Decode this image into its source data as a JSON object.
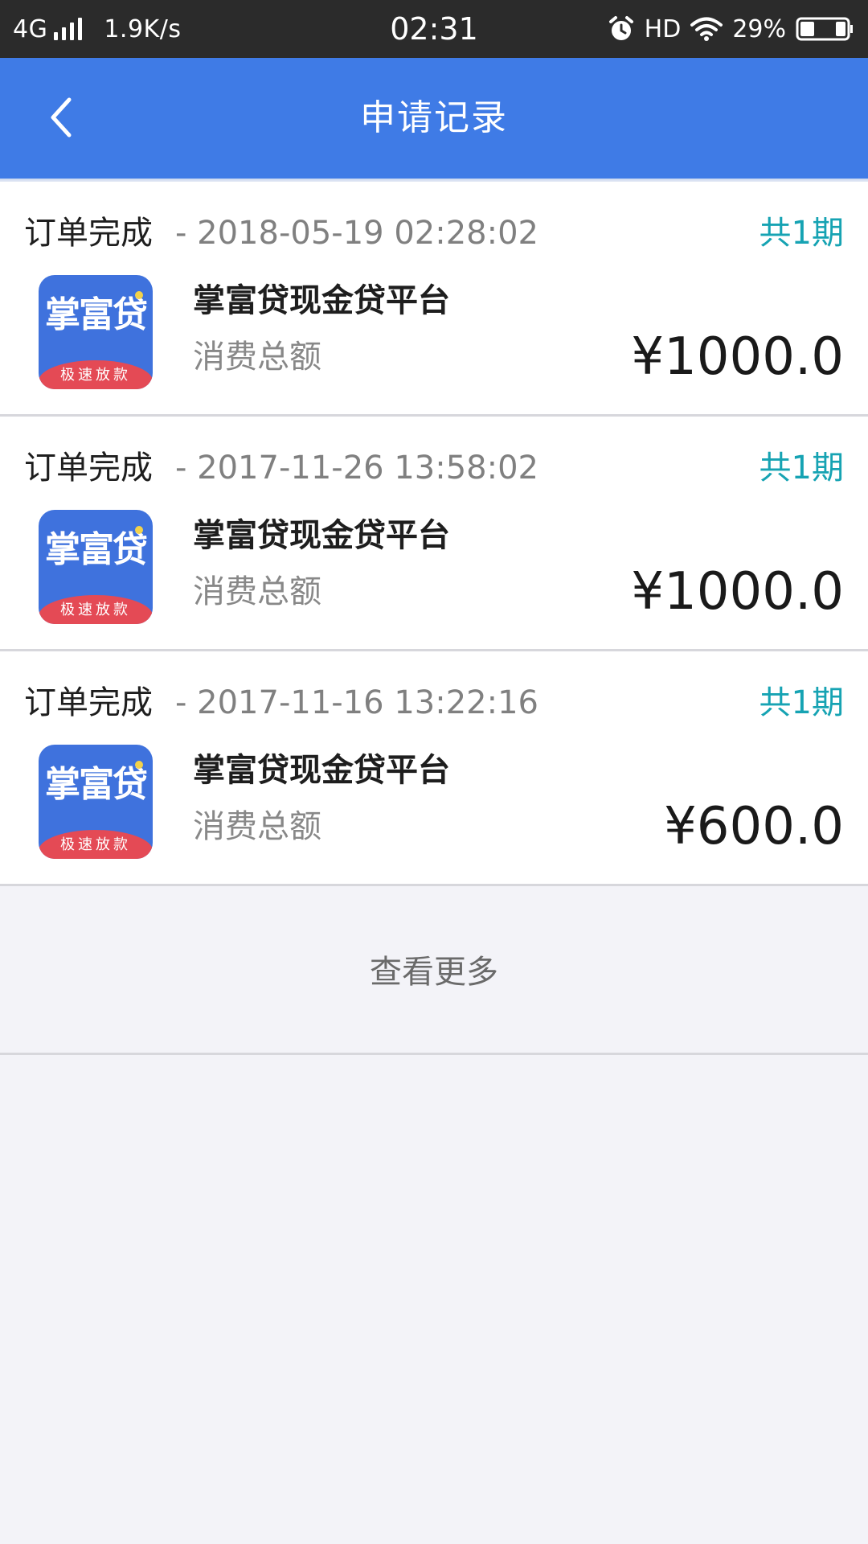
{
  "status_bar": {
    "network": "4G",
    "speed": "1.9K/s",
    "time": "02:31",
    "hd": "HD",
    "battery": "29%"
  },
  "header": {
    "title": "申请记录"
  },
  "orders": [
    {
      "status": "订单完成",
      "time": "- 2018-05-19 02:28:02",
      "periods": "共1期",
      "logo_text": "掌富贷",
      "logo_banner": "极速放款",
      "platform": "掌富贷现金贷平台",
      "amount_label": "消费总额",
      "amount": "¥1000.0"
    },
    {
      "status": "订单完成",
      "time": "- 2017-11-26 13:58:02",
      "periods": "共1期",
      "logo_text": "掌富贷",
      "logo_banner": "极速放款",
      "platform": "掌富贷现金贷平台",
      "amount_label": "消费总额",
      "amount": "¥1000.0"
    },
    {
      "status": "订单完成",
      "time": "- 2017-11-16 13:22:16",
      "periods": "共1期",
      "logo_text": "掌富贷",
      "logo_banner": "极速放款",
      "platform": "掌富贷现金贷平台",
      "amount_label": "消费总额",
      "amount": "¥600.0"
    }
  ],
  "load_more": "查看更多",
  "colors": {
    "header": "#3f7be6",
    "periods": "#16a3b3",
    "status_bar": "#2b2b2b"
  },
  "icons": {
    "back": "chevron-left-icon",
    "alarm": "alarm-clock-icon",
    "wifi": "wifi-icon",
    "battery": "battery-icon",
    "signal": "signal-bars-icon"
  }
}
